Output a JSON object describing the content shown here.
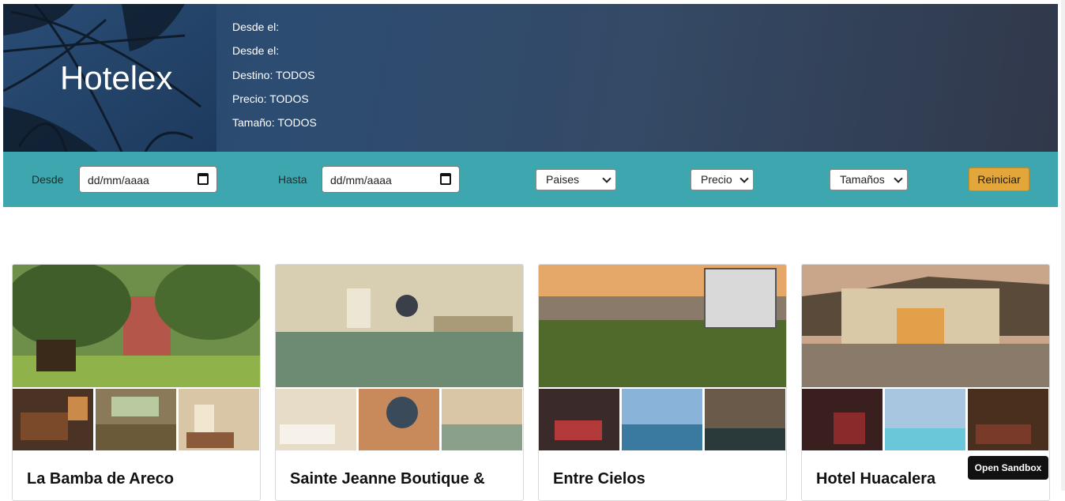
{
  "header": {
    "brand": "Hotelex",
    "summary": [
      {
        "text": "Desde el:"
      },
      {
        "text": "Desde el:"
      },
      {
        "text": "Destino: TODOS"
      },
      {
        "text": "Precio: TODOS"
      },
      {
        "text": "Tamaño: TODOS"
      }
    ]
  },
  "filters": {
    "desde_label": "Desde",
    "desde_value": "dd/mm/aaaa",
    "hasta_label": "Hasta",
    "hasta_value": "dd/mm/aaaa",
    "paises": "Paises",
    "precio": "Precio",
    "tamanos": "Tamaños",
    "reset": "Reiniciar"
  },
  "hotels": [
    {
      "name": "La Bamba de Areco"
    },
    {
      "name": "Sainte Jeanne Boutique &"
    },
    {
      "name": "Entre Cielos"
    },
    {
      "name": "Hotel Huacalera"
    }
  ],
  "sandbox_button": "Open Sandbox",
  "colors": {
    "filter_bar": "#3ea6ae",
    "reset_button": "#e3a63a",
    "hero": "#2c4c72"
  }
}
